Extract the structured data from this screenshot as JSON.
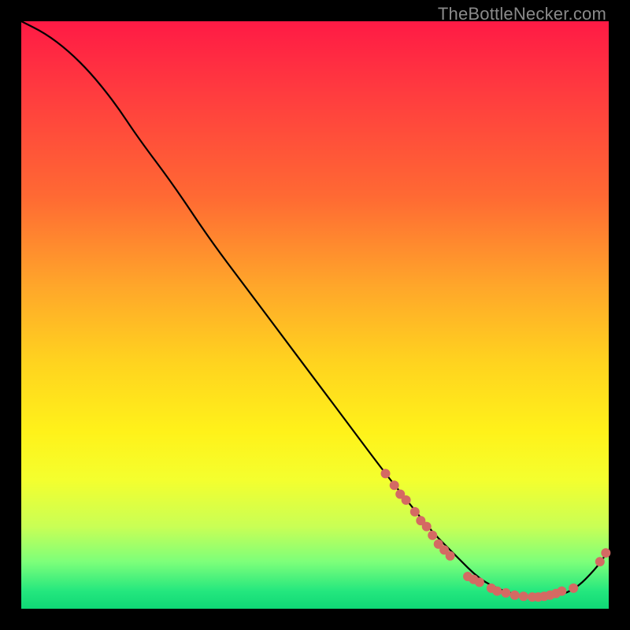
{
  "watermark": "TheBottleNecker.com",
  "chart_data": {
    "type": "line",
    "title": "",
    "xlabel": "",
    "ylabel": "",
    "xlim": [
      0,
      100
    ],
    "ylim": [
      0,
      100
    ],
    "series": [
      {
        "name": "curve",
        "x": [
          0,
          4,
          8,
          12,
          16,
          20,
          26,
          32,
          38,
          44,
          50,
          56,
          62,
          66,
          70,
          74,
          78,
          82,
          86,
          90,
          94,
          98,
          100
        ],
        "values": [
          100,
          98,
          95,
          91,
          86,
          80,
          72,
          63,
          55,
          47,
          39,
          31,
          23,
          18,
          13,
          9,
          5,
          3,
          2,
          2,
          3,
          7,
          10
        ]
      }
    ],
    "markers": [
      {
        "x": 62.0,
        "y": 23.0
      },
      {
        "x": 63.5,
        "y": 21.0
      },
      {
        "x": 64.5,
        "y": 19.5
      },
      {
        "x": 65.5,
        "y": 18.5
      },
      {
        "x": 67.0,
        "y": 16.5
      },
      {
        "x": 68.0,
        "y": 15.0
      },
      {
        "x": 69.0,
        "y": 14.0
      },
      {
        "x": 70.0,
        "y": 12.5
      },
      {
        "x": 71.0,
        "y": 11.0
      },
      {
        "x": 72.0,
        "y": 10.0
      },
      {
        "x": 73.0,
        "y": 9.0
      },
      {
        "x": 76.0,
        "y": 5.5
      },
      {
        "x": 77.0,
        "y": 5.0
      },
      {
        "x": 78.0,
        "y": 4.5
      },
      {
        "x": 80.0,
        "y": 3.5
      },
      {
        "x": 81.0,
        "y": 3.0
      },
      {
        "x": 82.5,
        "y": 2.7
      },
      {
        "x": 84.0,
        "y": 2.3
      },
      {
        "x": 85.5,
        "y": 2.1
      },
      {
        "x": 87.0,
        "y": 2.0
      },
      {
        "x": 88.0,
        "y": 2.0
      },
      {
        "x": 89.0,
        "y": 2.1
      },
      {
        "x": 90.0,
        "y": 2.3
      },
      {
        "x": 91.0,
        "y": 2.6
      },
      {
        "x": 92.0,
        "y": 3.0
      },
      {
        "x": 94.0,
        "y": 3.5
      },
      {
        "x": 98.5,
        "y": 8.0
      },
      {
        "x": 99.5,
        "y": 9.5
      }
    ],
    "marker_color": "#d46a63",
    "line_color": "#000000"
  }
}
